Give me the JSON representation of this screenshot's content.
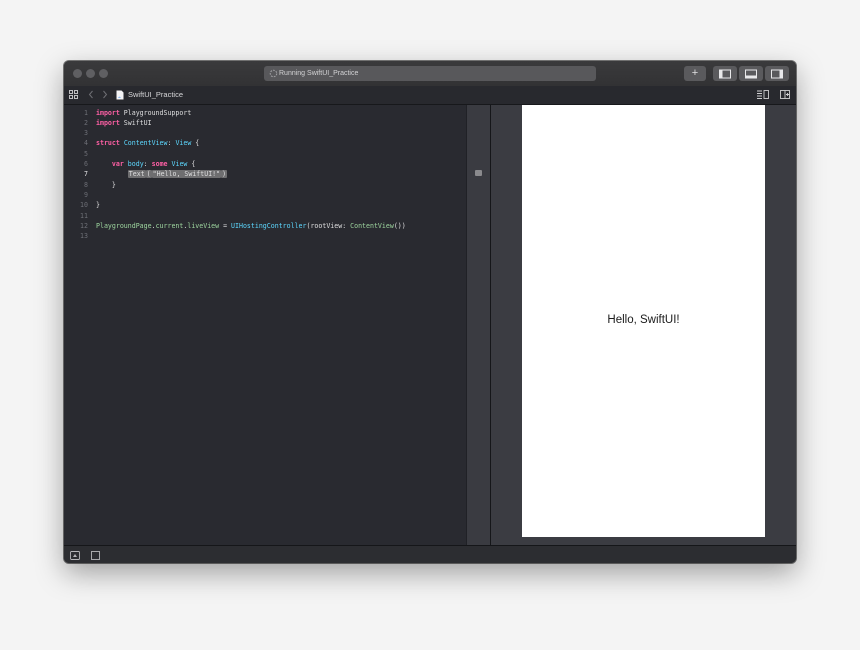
{
  "window": {
    "status_text": "Running SwiftUI_Practice",
    "add_label": "+"
  },
  "jumpbar": {
    "file_name": "SwiftUI_Practice"
  },
  "editor": {
    "lines": [
      {
        "n": "1",
        "tokens": [
          {
            "t": "import",
            "c": "kw"
          },
          {
            "t": " PlaygroundSupport",
            "c": ""
          }
        ]
      },
      {
        "n": "2",
        "tokens": [
          {
            "t": "import",
            "c": "kw"
          },
          {
            "t": " SwiftUI",
            "c": ""
          }
        ]
      },
      {
        "n": "3",
        "tokens": []
      },
      {
        "n": "4",
        "tokens": [
          {
            "t": "struct",
            "c": "kw"
          },
          {
            "t": " ",
            "c": ""
          },
          {
            "t": "ContentView",
            "c": "ty"
          },
          {
            "t": ": ",
            "c": ""
          },
          {
            "t": "View",
            "c": "ty"
          },
          {
            "t": " {",
            "c": ""
          }
        ]
      },
      {
        "n": "5",
        "tokens": []
      },
      {
        "n": "6",
        "tokens": [
          {
            "t": "    ",
            "c": ""
          },
          {
            "t": "var",
            "c": "kw"
          },
          {
            "t": " body",
            "c": "ty"
          },
          {
            "t": ": ",
            "c": ""
          },
          {
            "t": "some",
            "c": "kw"
          },
          {
            "t": " ",
            "c": ""
          },
          {
            "t": "View",
            "c": "ty"
          },
          {
            "t": " {",
            "c": ""
          }
        ]
      },
      {
        "n": "7",
        "tokens": [
          {
            "t": "        ",
            "c": ""
          },
          {
            "t": "Text",
            "c": "hl fn"
          },
          {
            "t": "(",
            "c": "hl"
          },
          {
            "t": "\"Hello, SwiftUI!\"",
            "c": "hl str"
          },
          {
            "t": ")",
            "c": "hl"
          }
        ]
      },
      {
        "n": "8",
        "tokens": [
          {
            "t": "    }",
            "c": ""
          }
        ]
      },
      {
        "n": "9",
        "tokens": []
      },
      {
        "n": "10",
        "tokens": [
          {
            "t": "}",
            "c": ""
          }
        ]
      },
      {
        "n": "11",
        "tokens": []
      },
      {
        "n": "12",
        "tokens": [
          {
            "t": "PlaygroundPage",
            "c": "nm"
          },
          {
            "t": ".",
            "c": ""
          },
          {
            "t": "current",
            "c": "nm"
          },
          {
            "t": ".",
            "c": ""
          },
          {
            "t": "liveView",
            "c": "nm"
          },
          {
            "t": " = ",
            "c": ""
          },
          {
            "t": "UIHostingController",
            "c": "ty"
          },
          {
            "t": "(rootView: ",
            "c": ""
          },
          {
            "t": "ContentView",
            "c": "nm"
          },
          {
            "t": "())",
            "c": ""
          }
        ]
      },
      {
        "n": "13",
        "tokens": []
      }
    ]
  },
  "live_view": {
    "text": "Hello, SwiftUI!"
  },
  "colors": {
    "editor_bg": "#292a30",
    "keyword": "#fc5fa3",
    "type": "#5dd8ff",
    "string": "#fc6a5d",
    "project_name": "#9ed69f"
  },
  "icons": [
    "grid-icon",
    "back-chevron-icon",
    "forward-chevron-icon",
    "swift-file-icon",
    "adjust-editor-icon",
    "add-editor-icon",
    "navigator-toggle-icon",
    "debug-area-toggle-icon",
    "inspector-toggle-icon",
    "run-icon",
    "stop-icon"
  ]
}
